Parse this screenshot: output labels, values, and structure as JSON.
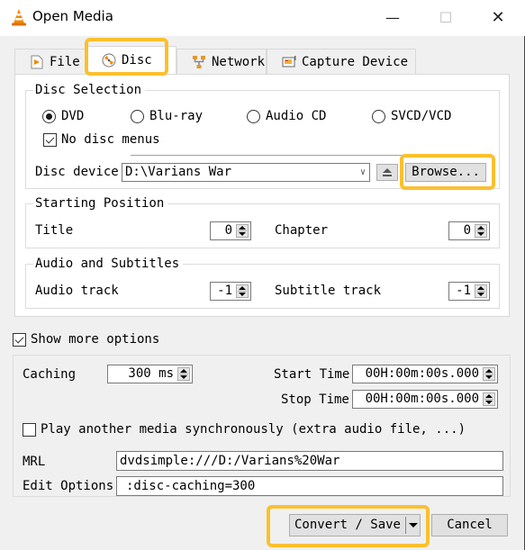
{
  "window": {
    "title": "Open Media",
    "app_icon": "vlc-cone-icon",
    "controls": {
      "minimize": "—",
      "maximize": "☐",
      "close": "✕"
    }
  },
  "tabs": [
    {
      "label": "File",
      "icon": "file-play-icon",
      "active": false
    },
    {
      "label": "Disc",
      "icon": "disc-icon",
      "active": true
    },
    {
      "label": "Network",
      "icon": "network-icon",
      "active": false
    },
    {
      "label": "Capture Device",
      "icon": "capture-device-icon",
      "active": false
    }
  ],
  "disc_selection": {
    "legend": "Disc Selection",
    "radios": [
      {
        "label": "DVD",
        "checked": true
      },
      {
        "label": "Blu-ray",
        "checked": false
      },
      {
        "label": "Audio CD",
        "checked": false
      },
      {
        "label": "SVCD/VCD",
        "checked": false
      }
    ],
    "no_disc_menus": {
      "label": "No disc menus",
      "checked": true
    },
    "disc_device_label": "Disc device",
    "disc_device_value": "D:\\Varians War",
    "browse_label": "Browse..."
  },
  "starting_position": {
    "legend": "Starting Position",
    "title_label": "Title",
    "title_value": "0",
    "chapter_label": "Chapter",
    "chapter_value": "0"
  },
  "audio_subtitles": {
    "legend": "Audio and Subtitles",
    "audio_label": "Audio track",
    "audio_value": "-1",
    "subtitle_label": "Subtitle track",
    "subtitle_value": "-1"
  },
  "more_options": {
    "show_label": "Show more options",
    "show_checked": true,
    "caching_label": "Caching",
    "caching_value": "300 ms",
    "start_time_label": "Start Time",
    "start_time_value": "00H:00m:00s.000",
    "stop_time_label": "Stop Time",
    "stop_time_value": "00H:00m:00s.000",
    "play_sync_label": "Play another media synchronously (extra audio file, ...)",
    "play_sync_checked": false,
    "mrl_label": "MRL",
    "mrl_value": "dvdsimple:///D:/Varians%20War",
    "edit_options_label": "Edit Options",
    "edit_options_value": ":disc-caching=300"
  },
  "footer": {
    "convert_save_label": "Convert / Save",
    "cancel_label": "Cancel"
  },
  "colors": {
    "highlight": "#fbc02d",
    "vlc_orange": "#f08a00"
  }
}
